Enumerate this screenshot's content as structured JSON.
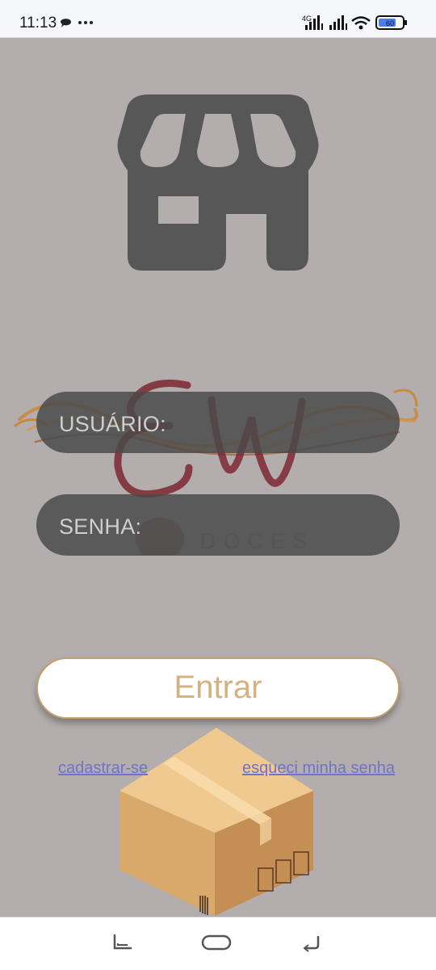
{
  "status_bar": {
    "time": "11:13",
    "network": "4G",
    "battery": "60"
  },
  "login": {
    "username_label": "USUÁRIO:",
    "password_label": "SENHA:",
    "submit_label": "Entrar",
    "register_link": "cadastrar-se",
    "forgot_link": "esqueci minha senha"
  },
  "logo": {
    "initials": "EW",
    "subtitle": "DOCES"
  },
  "colors": {
    "background": "#b3adad",
    "field_background": "#4a4a4a",
    "button_text": "#d4b17f",
    "link": "#6e74c8",
    "logo_red": "#7a1f2a"
  }
}
